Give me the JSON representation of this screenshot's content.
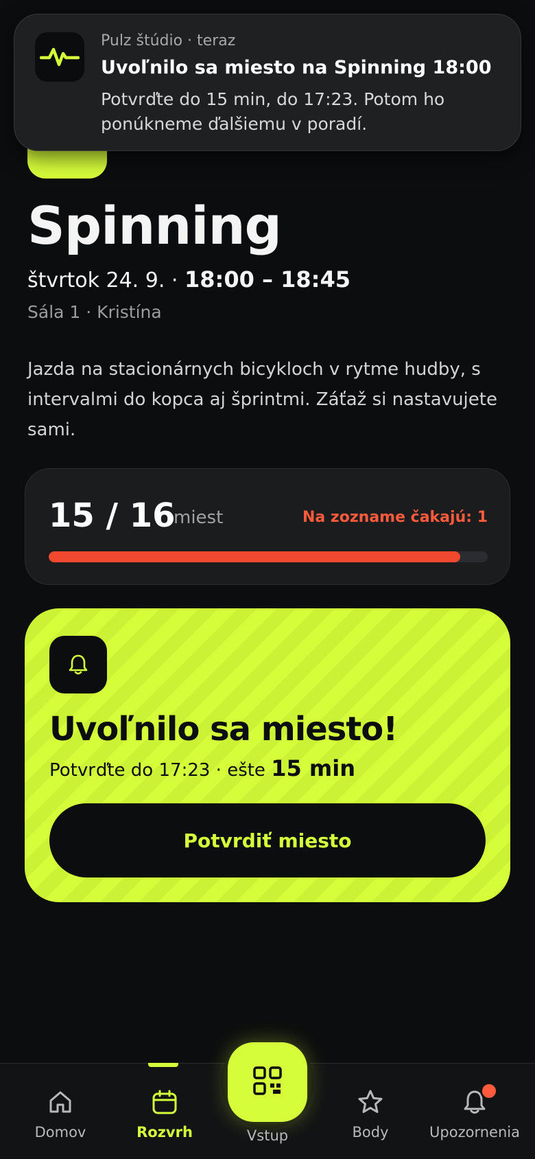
{
  "notification": {
    "app": "Pulz štúdio",
    "time": "teraz",
    "title": "Uvoľnilo sa miesto na Spinning 18:00",
    "body": "Potvrďte do 15 min, do 17:23. Potom ho ponúkneme ďalšiemu v poradí.",
    "icon": "pulse-icon"
  },
  "class": {
    "title": "Spinning",
    "day": "štvrtok 24. 9.",
    "time": "18:00 – 18:45",
    "room": "Sála 1",
    "trainer": "Kristína",
    "description": "Jazda na stacionárnych bicykloch v rytme hudby, s intervalmi do kopca aj šprintmi. Záťaž si nastavujete sami."
  },
  "capacity": {
    "count": "15 / 16",
    "unit": "miest",
    "waitlist": "Na zozname čakajú: 1",
    "fill_fraction": 0.9375
  },
  "spot": {
    "icon": "bell-icon",
    "title": "Uvoľnilo sa miesto!",
    "deadline": "Potvrďte do 17:23 · ešte",
    "remaining": "15 min",
    "button_label": "Potvrdiť miesto"
  },
  "nav": {
    "items": [
      {
        "label": "Domov",
        "icon": "home-icon"
      },
      {
        "label": "Rozvrh",
        "icon": "calendar-icon",
        "active": true
      },
      {
        "label": "Vstup",
        "icon": "qr-code-icon"
      },
      {
        "label": "Body",
        "icon": "star-icon"
      },
      {
        "label": "Upozornenia",
        "icon": "bell-icon",
        "badge": true
      }
    ]
  },
  "colors": {
    "accent": "#d6fd3a",
    "background": "#0c0d0e",
    "alert": "#ff5a3c"
  }
}
